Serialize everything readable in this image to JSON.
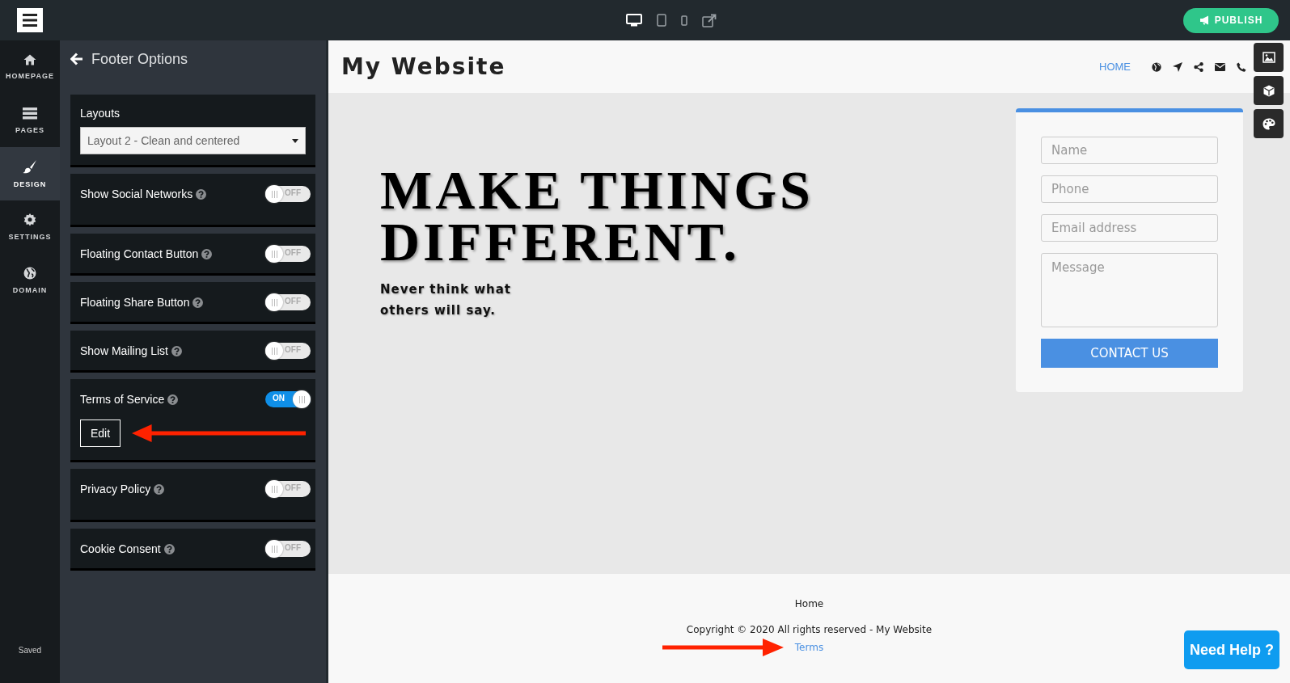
{
  "topbar": {
    "devices": [
      {
        "kind": "desktop",
        "selected": true
      },
      {
        "kind": "tablet",
        "selected": false
      },
      {
        "kind": "phone",
        "selected": false
      },
      {
        "kind": "external",
        "selected": false
      }
    ],
    "publish": "PUBLISH"
  },
  "nav": {
    "items": [
      {
        "kind": "home",
        "label": "HOMEPAGE",
        "selected": false
      },
      {
        "kind": "pages",
        "label": "PAGES",
        "selected": false
      },
      {
        "kind": "brush",
        "label": "DESIGN",
        "selected": true
      },
      {
        "kind": "gear",
        "label": "SETTINGS",
        "selected": false
      },
      {
        "kind": "globe",
        "label": "DOMAIN",
        "selected": false
      }
    ],
    "status": "Saved"
  },
  "panel": {
    "title": "Footer Options",
    "options": [
      {
        "kind": "select",
        "label": "Layouts",
        "value": "Layout 2 - Clean and centered"
      },
      {
        "kind": "toggle",
        "label": "Show Social Networks",
        "on": false,
        "state_text": "OFF"
      },
      {
        "kind": "toggle",
        "label": "Floating Contact Button",
        "on": false,
        "state_text": "OFF"
      },
      {
        "kind": "toggle",
        "label": "Floating Share Button",
        "on": false,
        "state_text": "OFF"
      },
      {
        "kind": "toggle",
        "label": "Show Mailing List",
        "on": false,
        "state_text": "OFF"
      },
      {
        "kind": "toggle",
        "label": "Terms of Service",
        "on": true,
        "state_text": "ON",
        "button": "Edit"
      },
      {
        "kind": "toggle",
        "label": "Privacy Policy",
        "on": false,
        "state_text": "OFF"
      },
      {
        "kind": "toggle",
        "label": "Cookie Consent",
        "on": false,
        "state_text": "OFF"
      }
    ]
  },
  "preview": {
    "site_title": "My Website",
    "menu": [
      {
        "label": "HOME",
        "selected": true
      }
    ],
    "hero": {
      "title": "MAKE THINGS DIFFERENT.",
      "subtitle": "Never think what others will say."
    },
    "form": {
      "fields": [
        {
          "kind": "input",
          "placeholder": "Name"
        },
        {
          "kind": "input",
          "placeholder": "Phone"
        },
        {
          "kind": "input",
          "placeholder": "Email address"
        },
        {
          "kind": "textarea",
          "placeholder": "Message"
        }
      ],
      "submit": "CONTACT US"
    },
    "footer": {
      "link": "Home",
      "copyright": "Copyright © 2020 All rights reserved - My Website",
      "terms": "Terms"
    }
  },
  "help_button": "Need Help ?"
}
